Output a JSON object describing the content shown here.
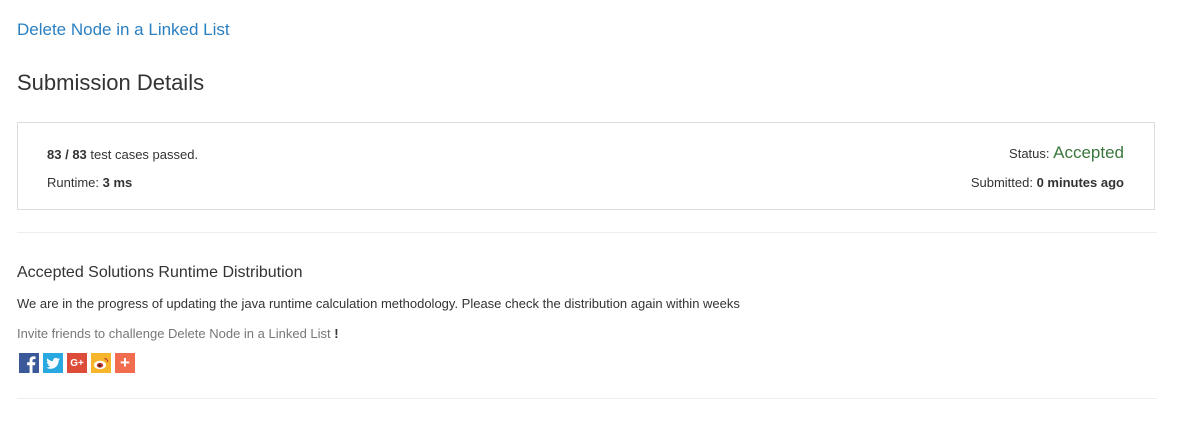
{
  "problem": {
    "title": "Delete Node in a Linked List"
  },
  "page_title": "Submission Details",
  "details": {
    "cases_passed": "83",
    "cases_separator": " / ",
    "cases_total": "83",
    "cases_suffix": " test cases passed.",
    "runtime_label": "Runtime: ",
    "runtime_value": "3 ms",
    "status_label": "Status: ",
    "status_value": "Accepted",
    "submitted_label": "Submitted: ",
    "submitted_value": "0 minutes ago"
  },
  "distribution": {
    "title": "Accepted Solutions Runtime Distribution",
    "note": "We are in the progress of updating the java runtime calculation methodology. Please check the distribution again within weeks"
  },
  "invite": {
    "text": "Invite friends to challenge Delete Node in a Linked List ",
    "bang": "!"
  },
  "share": {
    "google_label": "G+",
    "more_label": "+",
    "colors": {
      "facebook": "#3b5998",
      "twitter": "#2aa9e0",
      "google": "#dd4b39",
      "weibo": "#f7b52c",
      "more": "#f26d4f"
    },
    "icons": [
      "facebook-icon",
      "twitter-icon",
      "google-plus-icon",
      "weibo-icon",
      "plus-icon"
    ]
  },
  "colors": {
    "link": "#2a7fc1",
    "accepted": "#3c763d"
  }
}
